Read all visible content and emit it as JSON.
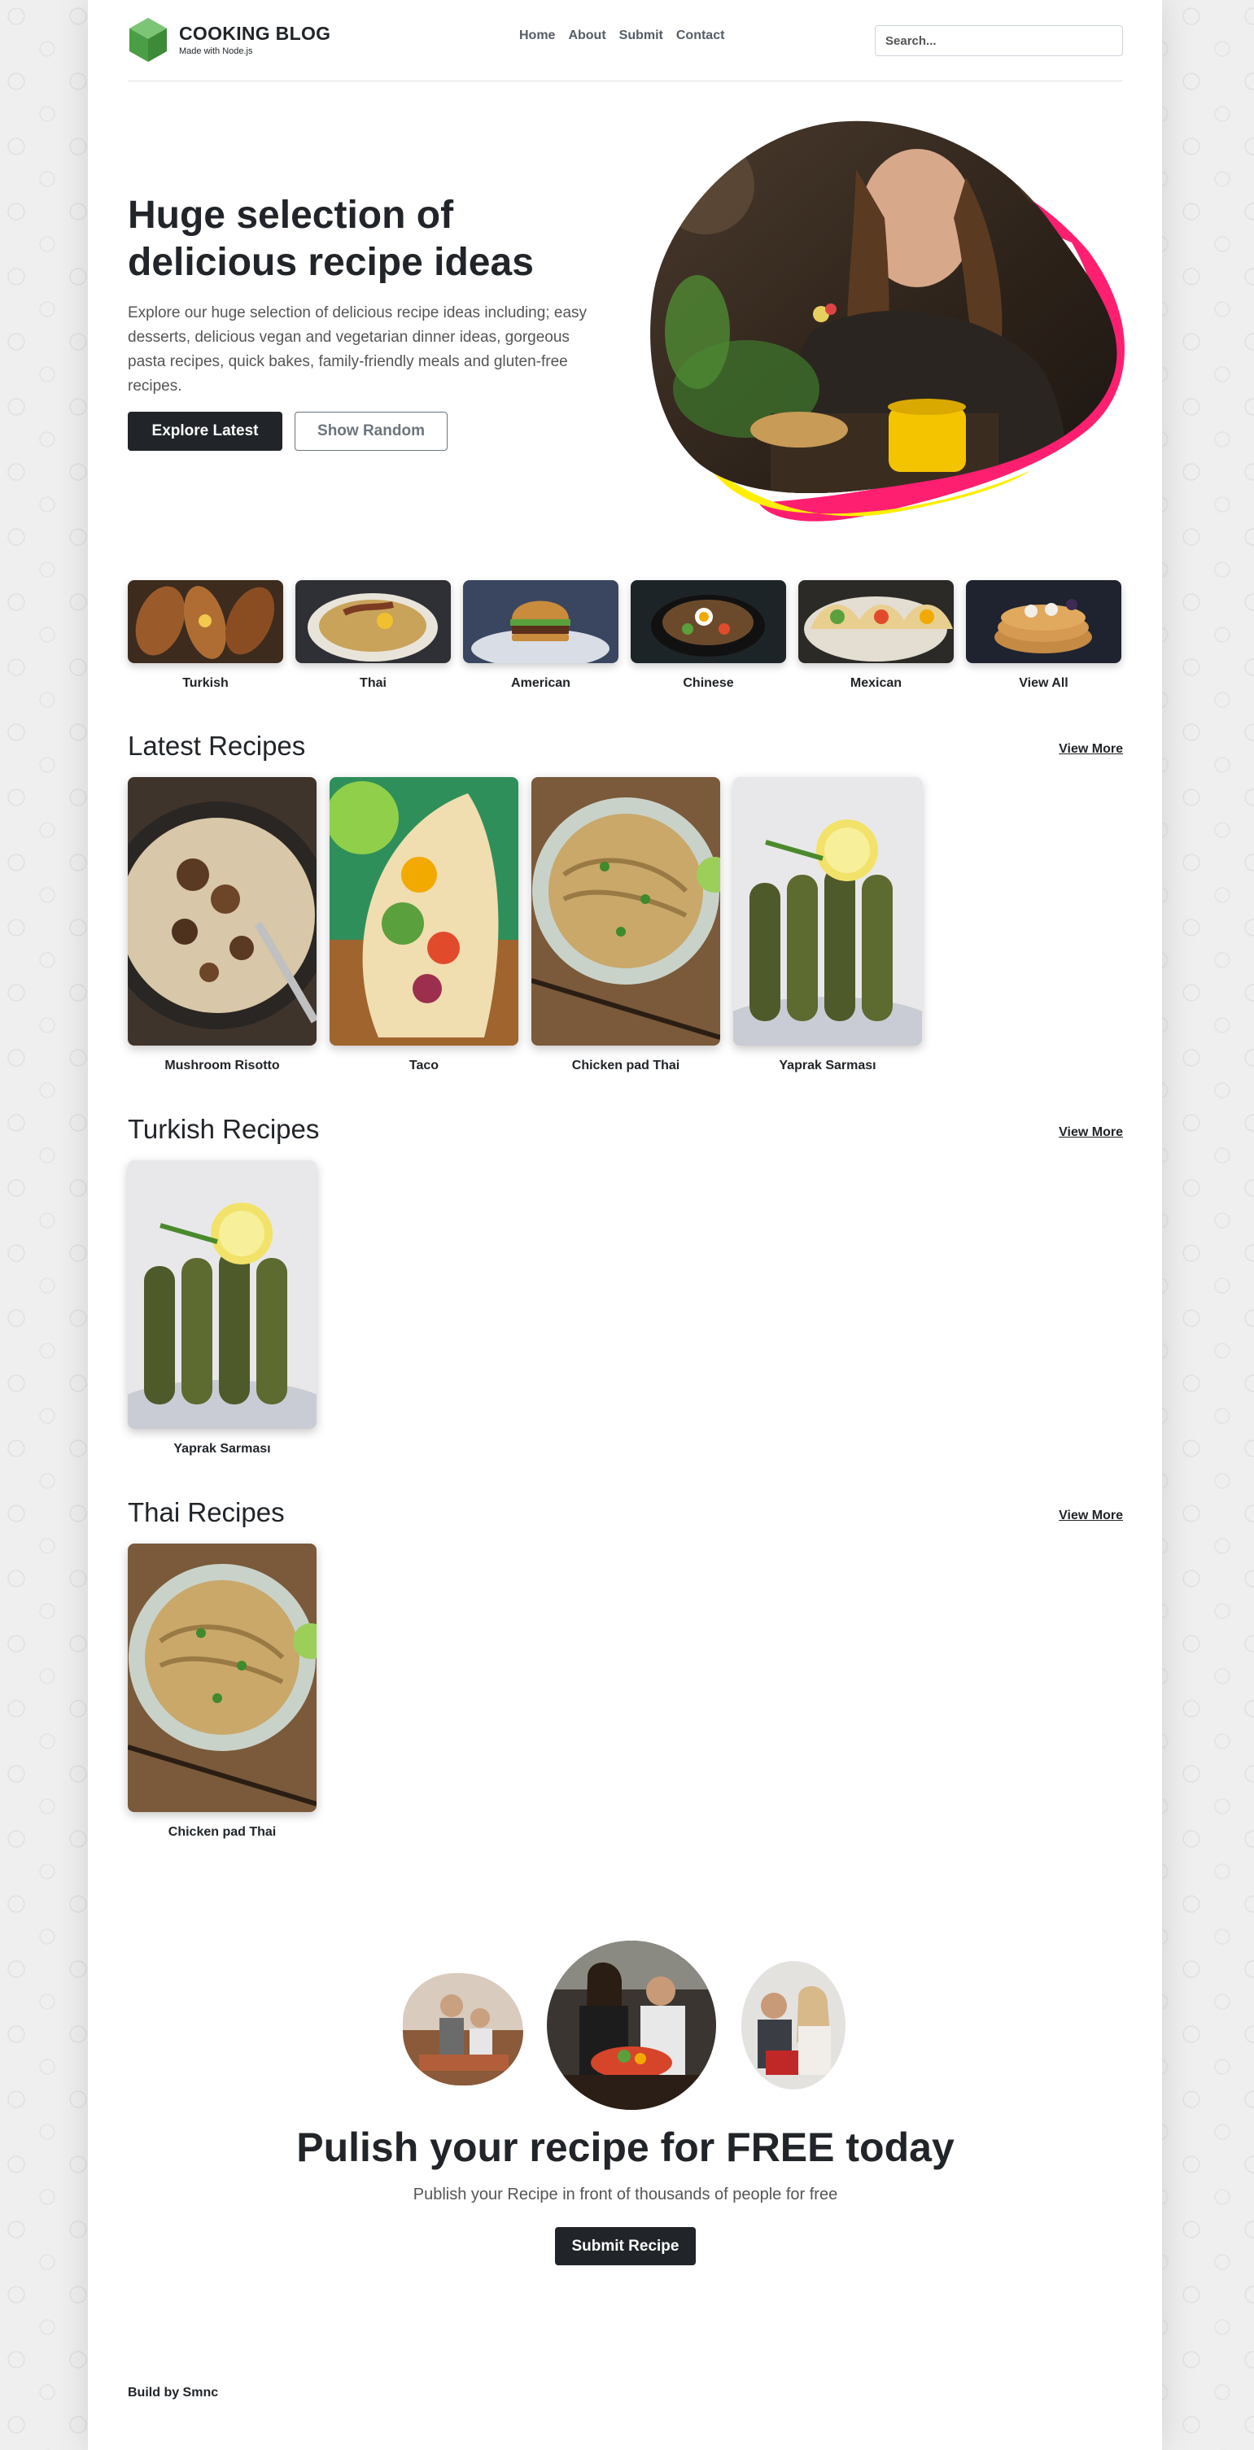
{
  "header": {
    "brand_title": "COOKING BLOG",
    "brand_subtitle": "Made with Node.js",
    "nav": [
      "Home",
      "About",
      "Submit",
      "Contact"
    ],
    "search_placeholder": "Search..."
  },
  "hero": {
    "title": "Huge selection of delicious recipe ideas",
    "text": "Explore our huge selection of delicious recipe ideas including; easy desserts, delicious vegan and vegetarian dinner ideas, gorgeous pasta recipes, quick bakes, family-friendly meals and gluten-free recipes.",
    "primary_button": "Explore Latest",
    "secondary_button": "Show Random"
  },
  "categories": [
    "Turkish",
    "Thai",
    "American",
    "Chinese",
    "Mexican",
    "View All"
  ],
  "latest": {
    "title": "Latest Recipes",
    "view_more": "View More",
    "items": [
      "Mushroom Risotto",
      "Taco",
      "Chicken pad Thai",
      "Yaprak Sarması"
    ]
  },
  "turkish": {
    "title": "Turkish Recipes",
    "view_more": "View More",
    "items": [
      "Yaprak Sarması"
    ]
  },
  "thai": {
    "title": "Thai Recipes",
    "view_more": "View More",
    "items": [
      "Chicken pad Thai"
    ]
  },
  "cta": {
    "title": "Pulish your recipe for FREE today",
    "subtitle": "Publish your Recipe in front of thousands of people for free",
    "button": "Submit Recipe"
  },
  "footer": {
    "text": "Build by Smnc"
  },
  "colors": {
    "dark": "#212529",
    "logo_green": "#5cb85c",
    "blob_pink": "#ff1f70",
    "blob_yellow": "#ffee00"
  }
}
